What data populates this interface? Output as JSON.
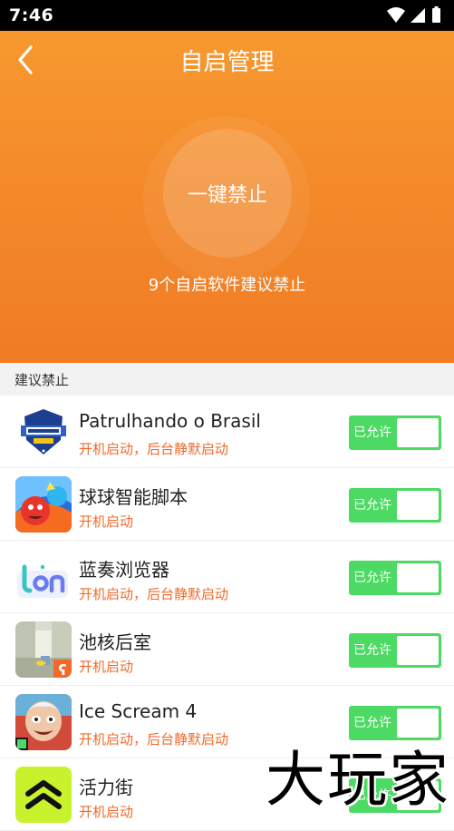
{
  "status_bar": {
    "time": "7:46"
  },
  "header": {
    "title": "自启管理",
    "action_button": "一键禁止",
    "summary": "9个自启软件建议禁止"
  },
  "section": {
    "title": "建议禁止"
  },
  "apps": [
    {
      "name": "Patrulhando o Brasil",
      "status": "开机启动，后台静默启动",
      "toggle_label": "已允许",
      "icon": "patrulhando-icon"
    },
    {
      "name": "球球智能脚本",
      "status": "开机启动",
      "toggle_label": "已允许",
      "icon": "qiuqiu-icon"
    },
    {
      "name": "蓝奏浏览器",
      "status": "开机启动，后台静默启动",
      "toggle_label": "已允许",
      "icon": "lanzou-icon"
    },
    {
      "name": "池核后室",
      "status": "开机启动",
      "toggle_label": "已允许",
      "icon": "backrooms-icon"
    },
    {
      "name": "Ice Scream 4",
      "status": "开机启动，后台静默启动",
      "toggle_label": "已允许",
      "icon": "ice-scream-icon"
    },
    {
      "name": "活力街",
      "status": "开机启动",
      "toggle_label": "已允许",
      "icon": "huolijie-icon"
    }
  ],
  "watermark": {
    "text": "大玩家"
  },
  "colors": {
    "accent": "#f48a2a",
    "toggle_on": "#4cd964",
    "status_text": "#f06a2b"
  }
}
